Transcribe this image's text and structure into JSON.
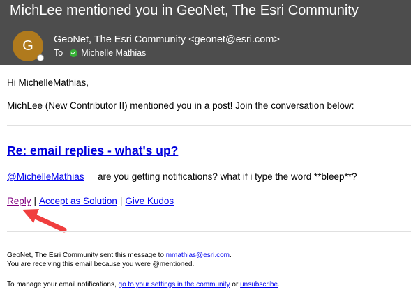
{
  "email": {
    "subject": "MichLee mentioned you in GeoNet, The Esri Community",
    "avatar_letter": "G",
    "sender": "GeoNet, The Esri Community <geonet@esri.com>",
    "to_label": "To",
    "recipient": "Michelle Mathias",
    "accent_color": "#b07a1d"
  },
  "body": {
    "greeting": "Hi MichelleMathias,",
    "intro": "MichLee (New Contributor II) mentioned you in a post! Join the conversation below:",
    "post_title": "Re: email replies - what's up?",
    "mention": "@MichelleMathias",
    "post_text": "are you getting notifications? what if i type the word **bleep**?",
    "actions": {
      "reply": "Reply",
      "separator": "|",
      "accept": "Accept as Solution",
      "kudos": "Give Kudos"
    }
  },
  "footer": {
    "line1_prefix": "GeoNet, The Esri Community sent this message to",
    "line1_email": "mmathias@esri.com",
    "line1_suffix": ".",
    "line2": "You are receiving this email because you were @mentioned.",
    "line3_prefix": "To manage your email notifications,",
    "settings_link": "go to your settings in the community",
    "line3_or": "or",
    "unsubscribe_link": "unsubscribe",
    "line3_suffix": "."
  }
}
